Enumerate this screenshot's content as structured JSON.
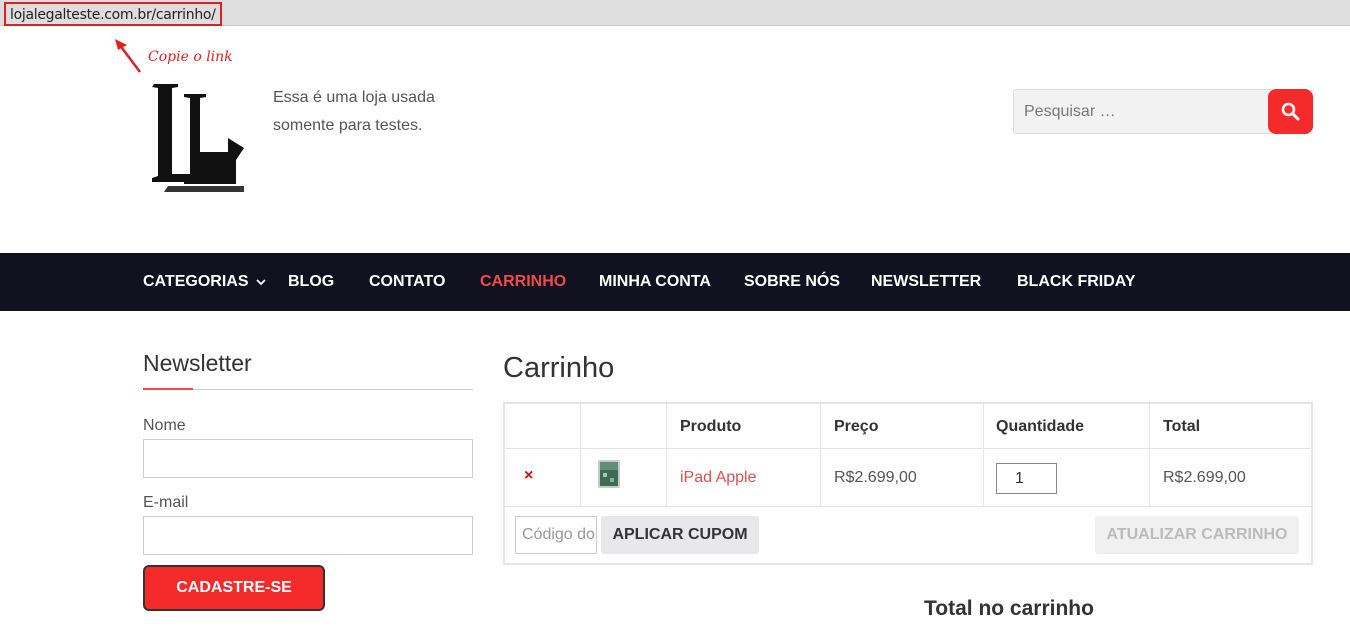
{
  "browser": {
    "url": "lojalegalteste.com.br/carrinho/"
  },
  "annotation": {
    "text": "Copie o link",
    "color": "#e02020"
  },
  "header": {
    "tagline_line1": "Essa é uma loja usada",
    "tagline_line2": "somente para testes.",
    "search_placeholder": "Pesquisar …",
    "logo_letters": "LL"
  },
  "nav": {
    "items": [
      {
        "label": "CATEGORIAS"
      },
      {
        "label": "BLOG"
      },
      {
        "label": "CONTATO"
      },
      {
        "label": "CARRINHO"
      },
      {
        "label": "MINHA CONTA"
      },
      {
        "label": "SOBRE NÓS"
      },
      {
        "label": "NEWSLETTER"
      },
      {
        "label": "BLACK FRIDAY"
      }
    ],
    "active": "CARRINHO",
    "background": "#12111f",
    "active_color": "#f24a4a"
  },
  "newsletter": {
    "title": "Newsletter",
    "name_label": "Nome",
    "email_label": "E-mail",
    "submit_label": "CADASTRE-SE"
  },
  "cart": {
    "title": "Carrinho",
    "headers": {
      "product": "Produto",
      "price": "Preço",
      "quantity": "Quantidade",
      "total": "Total"
    },
    "row": {
      "remove_symbol": "×",
      "product": "iPad Apple",
      "price": "R$2.699,00",
      "quantity": "1",
      "total": "R$2.699,00"
    },
    "coupon_placeholder": "Código do cupom",
    "apply_coupon_label": "APLICAR CUPOM",
    "update_cart_label": "ATUALIZAR CARRINHO",
    "totals_title": "Total no carrinho"
  },
  "colors": {
    "accent": "#f52a2a",
    "link": "#e05050"
  }
}
